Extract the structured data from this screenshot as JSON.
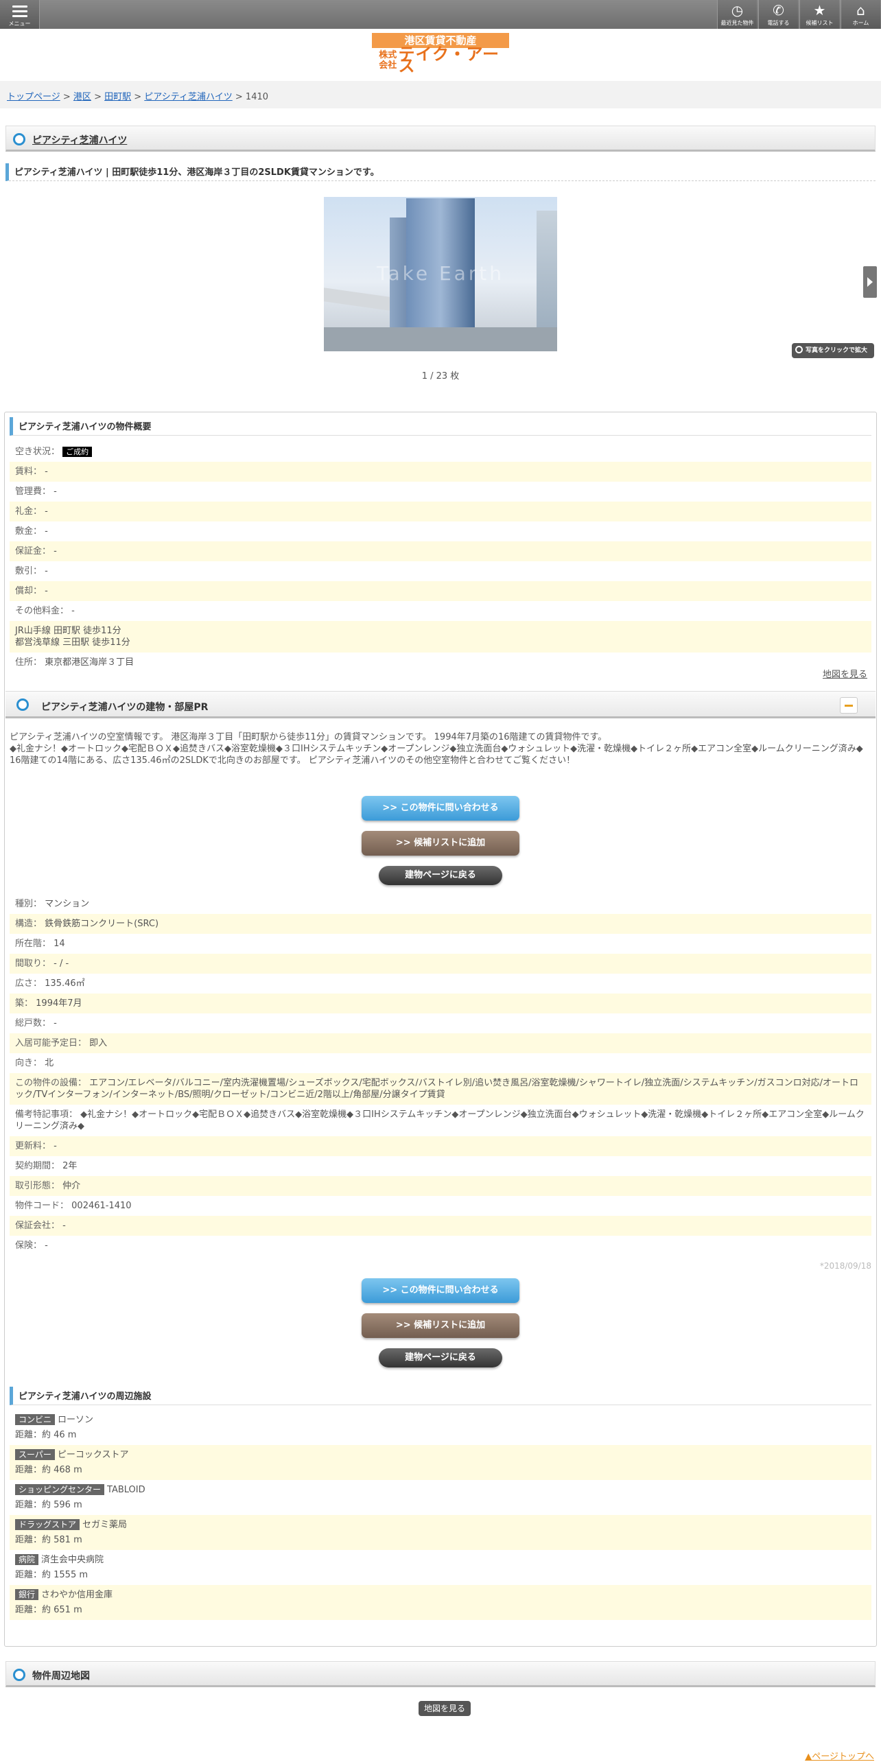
{
  "header": {
    "menu_label": "メニュー",
    "buttons": [
      {
        "label": "最近見た物件",
        "icon": "clock-icon"
      },
      {
        "label": "電話する",
        "icon": "phone-icon"
      },
      {
        "label": "候補リスト",
        "icon": "star-icon"
      },
      {
        "label": "ホーム",
        "icon": "home-icon"
      }
    ]
  },
  "logo": {
    "band": "港区賃貸不動産",
    "kabushiki": "株式会社",
    "name": "テイク・アース"
  },
  "breadcrumb": {
    "items": [
      "トップページ",
      "港区",
      "田町駅",
      "ピアシティ芝浦ハイツ"
    ],
    "current": "1410",
    "sep": " > "
  },
  "title": "ピアシティ芝浦ハイツ",
  "lead": "ピアシティ芝浦ハイツ | 田町駅徒歩11分、港区海岸３丁目の2SLDK賃貸マンションです。",
  "photo": {
    "watermark": "Take Earth",
    "counter": "1 / 23 枚",
    "zoom_label": "写真をクリックで拡大"
  },
  "overview": {
    "heading": "ピアシティ芝浦ハイツの物件概要",
    "status_label": "空き状況：",
    "status_value": "ご成約",
    "rows": [
      {
        "k": "賃料：",
        "v": "-"
      },
      {
        "k": "管理費：",
        "v": "-"
      },
      {
        "k": "礼金：",
        "v": "-"
      },
      {
        "k": "敷金：",
        "v": "-"
      },
      {
        "k": "保証金：",
        "v": "-"
      },
      {
        "k": "敷引：",
        "v": "-"
      },
      {
        "k": "償却：",
        "v": "-"
      },
      {
        "k": "その他料金：",
        "v": "-"
      }
    ],
    "access": [
      "JR山手線 田町駅 徒歩11分",
      "都営浅草線 三田駅 徒歩11分"
    ],
    "address_label": "住所：",
    "address": "東京都港区海岸３丁目",
    "map_link": "地図を見る"
  },
  "pr": {
    "heading": "ピアシティ芝浦ハイツの建物・部屋PR",
    "text": [
      "ピアシティ芝浦ハイツの空室情報です。 港区海岸３丁目「田町駅から徒歩11分」の賃貸マンションです。 1994年7月築の16階建ての賃貸物件です。",
      "◆礼金ナシ！◆オートロック◆宅配ＢＯＸ◆追焚きバス◆浴室乾燥機◆３口IHシステムキッチン◆オープンレンジ◆独立洗面台◆ウォシュレット◆洗濯・乾燥機◆トイレ２ヶ所◆エアコン全室◆ルームクリーニング済み◆",
      "16階建ての14階にある、広さ135.46㎡の2SLDKで北向きのお部屋です。 ピアシティ芝浦ハイツのその他空室物件と合わせてご覧ください！"
    ],
    "btn_inquiry": ">> この物件に問い合わせる",
    "btn_list": ">> 候補リストに追加",
    "btn_back": "建物ページに戻る",
    "rows": [
      {
        "k": "種別：",
        "v": "マンション"
      },
      {
        "k": "構造：",
        "v": "鉄骨鉄筋コンクリート(SRC)"
      },
      {
        "k": "所在階：",
        "v": "14"
      },
      {
        "k": "間取り：",
        "v": "- / -"
      },
      {
        "k": "広さ：",
        "v": "135.46㎡"
      },
      {
        "k": "築：",
        "v": "1994年7月"
      },
      {
        "k": "総戸数：",
        "v": "-"
      },
      {
        "k": "入居可能予定日：",
        "v": "即入"
      },
      {
        "k": "向き：",
        "v": "北"
      },
      {
        "k": "この物件の設備：",
        "v": "エアコン/エレベータ/バルコニー/室内洗濯機置場/シューズボックス/宅配ボックス/バストイレ別/追い焚き風呂/浴室乾燥機/シャワートイレ/独立洗面/システムキッチン/ガスコンロ対応/オートロック/TVインターフォン/インターネット/BS/照明/クローゼット/コンビニ近/2階以上/角部屋/分譲タイプ賃貸"
      },
      {
        "k": "備考特記事項：",
        "v": "◆礼金ナシ！◆オートロック◆宅配ＢＯＸ◆追焚きバス◆浴室乾燥機◆３口IHシステムキッチン◆オープンレンジ◆独立洗面台◆ウォシュレット◆洗濯・乾燥機◆トイレ２ヶ所◆エアコン全室◆ルームクリーニング済み◆"
      },
      {
        "k": "更新料：",
        "v": "-"
      },
      {
        "k": "契約期間：",
        "v": "2年"
      },
      {
        "k": "取引形態：",
        "v": "仲介"
      },
      {
        "k": "物件コード：",
        "v": "002461-1410"
      },
      {
        "k": "保証会社：",
        "v": "-"
      },
      {
        "k": "保険：",
        "v": "-"
      }
    ],
    "date": "*2018/09/18"
  },
  "nearby": {
    "heading": "ピアシティ芝浦ハイツの周辺施設",
    "items": [
      {
        "cat": "コンビニ",
        "name": "ローソン",
        "dist": "距離：約 46 m"
      },
      {
        "cat": "スーパー",
        "name": "ピーコックストア",
        "dist": "距離：約 468 m"
      },
      {
        "cat": "ショッピングセンター",
        "name": "TABLOID",
        "dist": "距離：約 596 m"
      },
      {
        "cat": "ドラッグストア",
        "name": "セガミ薬局",
        "dist": "距離：約 581 m"
      },
      {
        "cat": "病院",
        "name": "済生会中央病院",
        "dist": "距離：約 1555 m"
      },
      {
        "cat": "銀行",
        "name": "さわやか信用金庫",
        "dist": "距離：約 651 m"
      }
    ]
  },
  "map": {
    "heading": "物件周辺地図",
    "button": "地図を見る"
  },
  "pagetop": "▲ページトップへ"
}
